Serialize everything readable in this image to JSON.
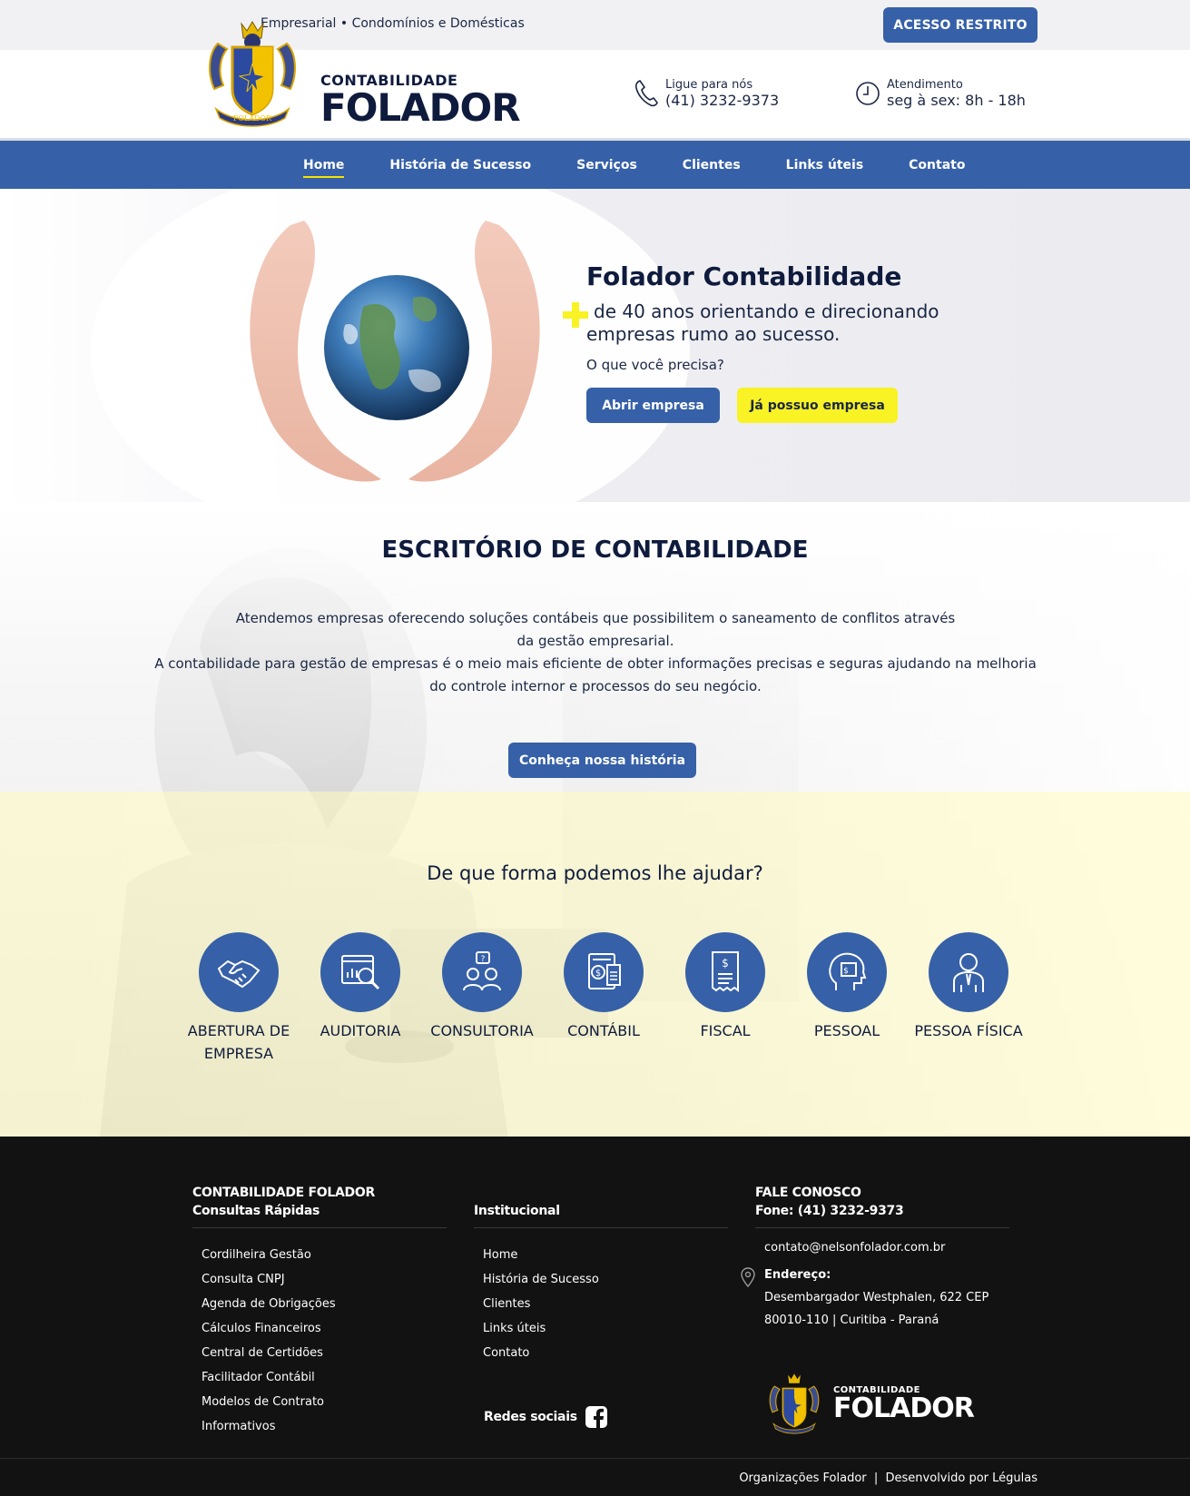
{
  "topbar": {
    "tagline": "Empresarial • Condomínios e Domésticas",
    "restricted_button": "ACESSO RESTRITO"
  },
  "brand": {
    "small": "CONTABILIDADE",
    "big": "FOLADOR",
    "crest_text": "FOLADOR"
  },
  "header": {
    "phone_label": "Ligue para nós",
    "phone_value": "(41) 3232-9373",
    "hours_label": "Atendimento",
    "hours_value": "seg à sex: 8h - 18h"
  },
  "nav": {
    "items": [
      "Home",
      "História de Sucesso",
      "Serviços",
      "Clientes",
      "Links úteis",
      "Contato"
    ],
    "active": "Home"
  },
  "hero": {
    "title": "Folador Contabilidade",
    "subtitle": "de 40 anos orientando e direcionando empresas rumo ao sucesso.",
    "question": "O que você precisa?",
    "btn_open": "Abrir empresa",
    "btn_have": "Já possuo empresa"
  },
  "office": {
    "title": "ESCRITÓRIO DE CONTABILIDADE",
    "line1": "Atendemos empresas oferecendo soluções contábeis que possibilitem o saneamento de conflitos através",
    "line2": "da gestão empresarial.",
    "line3": "A contabilidade para gestão de empresas é o meio mais eficiente de obter informações precisas e seguras ajudando na melhoria",
    "line4": "do controle internor e processos do seu negócio.",
    "button": "Conheça nossa história"
  },
  "help": {
    "title": "De que forma podemos lhe ajudar?",
    "services": [
      {
        "label": "ABERTURA DE EMPRESA",
        "icon": "handshake-icon"
      },
      {
        "label": "AUDITORIA",
        "icon": "audit-magnifier-icon"
      },
      {
        "label": "CONSULTORIA",
        "icon": "consulting-people-icon"
      },
      {
        "label": "CONTÁBIL",
        "icon": "accounting-calculator-icon"
      },
      {
        "label": "FISCAL",
        "icon": "receipt-icon"
      },
      {
        "label": "PESSOAL",
        "icon": "head-thinking-icon"
      },
      {
        "label": "PESSOA FÍSICA",
        "icon": "person-tie-icon"
      }
    ]
  },
  "footer": {
    "col1_title1": "CONTABILIDADE FOLADOR",
    "col1_title2": "Consultas Rápidas",
    "col1_links": [
      "Cordilheira Gestão",
      "Consulta CNPJ",
      "Agenda de Obrigações",
      "Cálculos Financeiros",
      "Central de Certidões",
      "Facilitador Contábil",
      "Modelos de Contrato",
      "Informativos"
    ],
    "col2_title": "Institucional",
    "col2_links": [
      "Home",
      "História de Sucesso",
      "Clientes",
      "Links úteis",
      "Contato"
    ],
    "col3_title1": "FALE CONOSCO",
    "col3_title2": "Fone: (41) 3232-9373",
    "email": "contato@nelsonfolador.com.br",
    "address_label": "Endereço:",
    "address_line1": "Desembargador Westphalen, 622 CEP",
    "address_line2": "80010-110 | Curitiba - Paraná",
    "social_label": "Redes sociais",
    "logo_small": "CONTABILIDADE",
    "logo_big": "FOLADOR",
    "credits": "Organizações Folador  |  Desenvolvido por Légulas"
  },
  "colors": {
    "primary_blue": "#3660a8",
    "navy": "#0f1b3d",
    "yellow": "#f9f224",
    "footer_bg": "#121212"
  }
}
